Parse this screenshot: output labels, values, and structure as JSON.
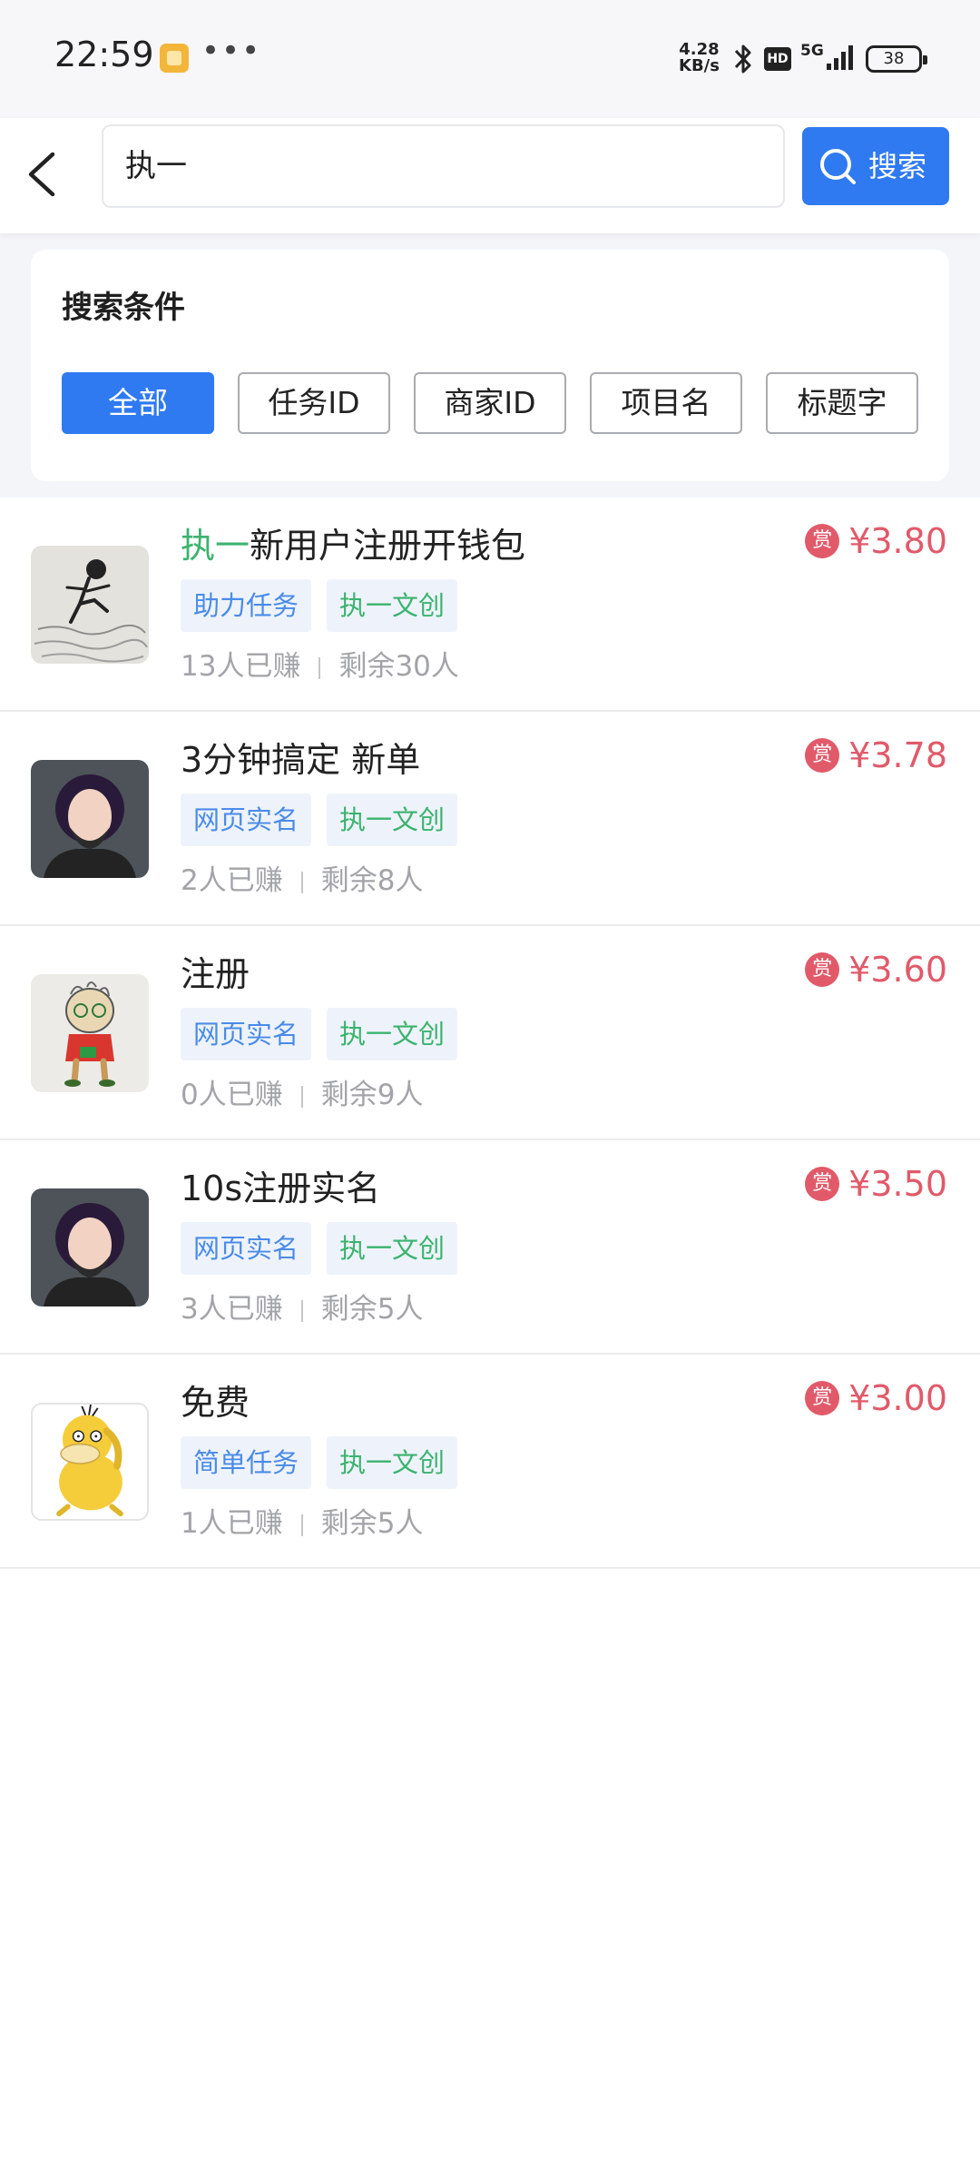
{
  "status_bar": {
    "time": "22:59",
    "dots": "•••",
    "net_speed_value": "4.28",
    "net_speed_unit": "KB/s",
    "hd": "HD",
    "signal_label": "5G",
    "battery": "38",
    "icons": [
      "app-notification-icon",
      "bluetooth-icon",
      "hd-icon",
      "signal-icon",
      "battery-icon"
    ]
  },
  "header": {
    "search_value": "执一",
    "search_button": "搜索"
  },
  "filter": {
    "title": "搜索条件",
    "options": [
      "全部",
      "任务ID",
      "商家ID",
      "项目名",
      "标题字"
    ],
    "selected": "全部"
  },
  "tasks": [
    {
      "title_highlight": "执一",
      "title_rest": "新用户注册开钱包",
      "tag_type": "助力任务",
      "tag_shop": "执一文创",
      "earned": "13人已赚",
      "remaining": "剩余30人",
      "reward_badge": "赏",
      "price": "¥3.80",
      "avatar": "sketch-avatar"
    },
    {
      "title_highlight": "",
      "title_rest": "3分钟搞定 新单",
      "tag_type": "网页实名",
      "tag_shop": "执一文创",
      "earned": "2人已赚",
      "remaining": "剩余8人",
      "reward_badge": "赏",
      "price": "¥3.78",
      "avatar": "bearded-man-avatar"
    },
    {
      "title_highlight": "",
      "title_rest": "注册",
      "tag_type": "网页实名",
      "tag_shop": "执一文创",
      "earned": "0人已赚",
      "remaining": "剩余9人",
      "reward_badge": "赏",
      "price": "¥3.60",
      "avatar": "cartoon-old-man-avatar"
    },
    {
      "title_highlight": "",
      "title_rest": "10s注册实名",
      "tag_type": "网页实名",
      "tag_shop": "执一文创",
      "earned": "3人已赚",
      "remaining": "剩余5人",
      "reward_badge": "赏",
      "price": "¥3.50",
      "avatar": "bearded-man-avatar"
    },
    {
      "title_highlight": "",
      "title_rest": "免费",
      "tag_type": "简单任务",
      "tag_shop": "执一文创",
      "earned": "1人已赚",
      "remaining": "剩余5人",
      "reward_badge": "赏",
      "price": "¥3.00",
      "avatar": "psyduck-avatar"
    }
  ],
  "colors": {
    "primary": "#2f7af1",
    "highlight": "#3bb36e",
    "price": "#e15a6a",
    "tag_type_text": "#4a8be8",
    "muted_text": "#a2a4a8"
  }
}
